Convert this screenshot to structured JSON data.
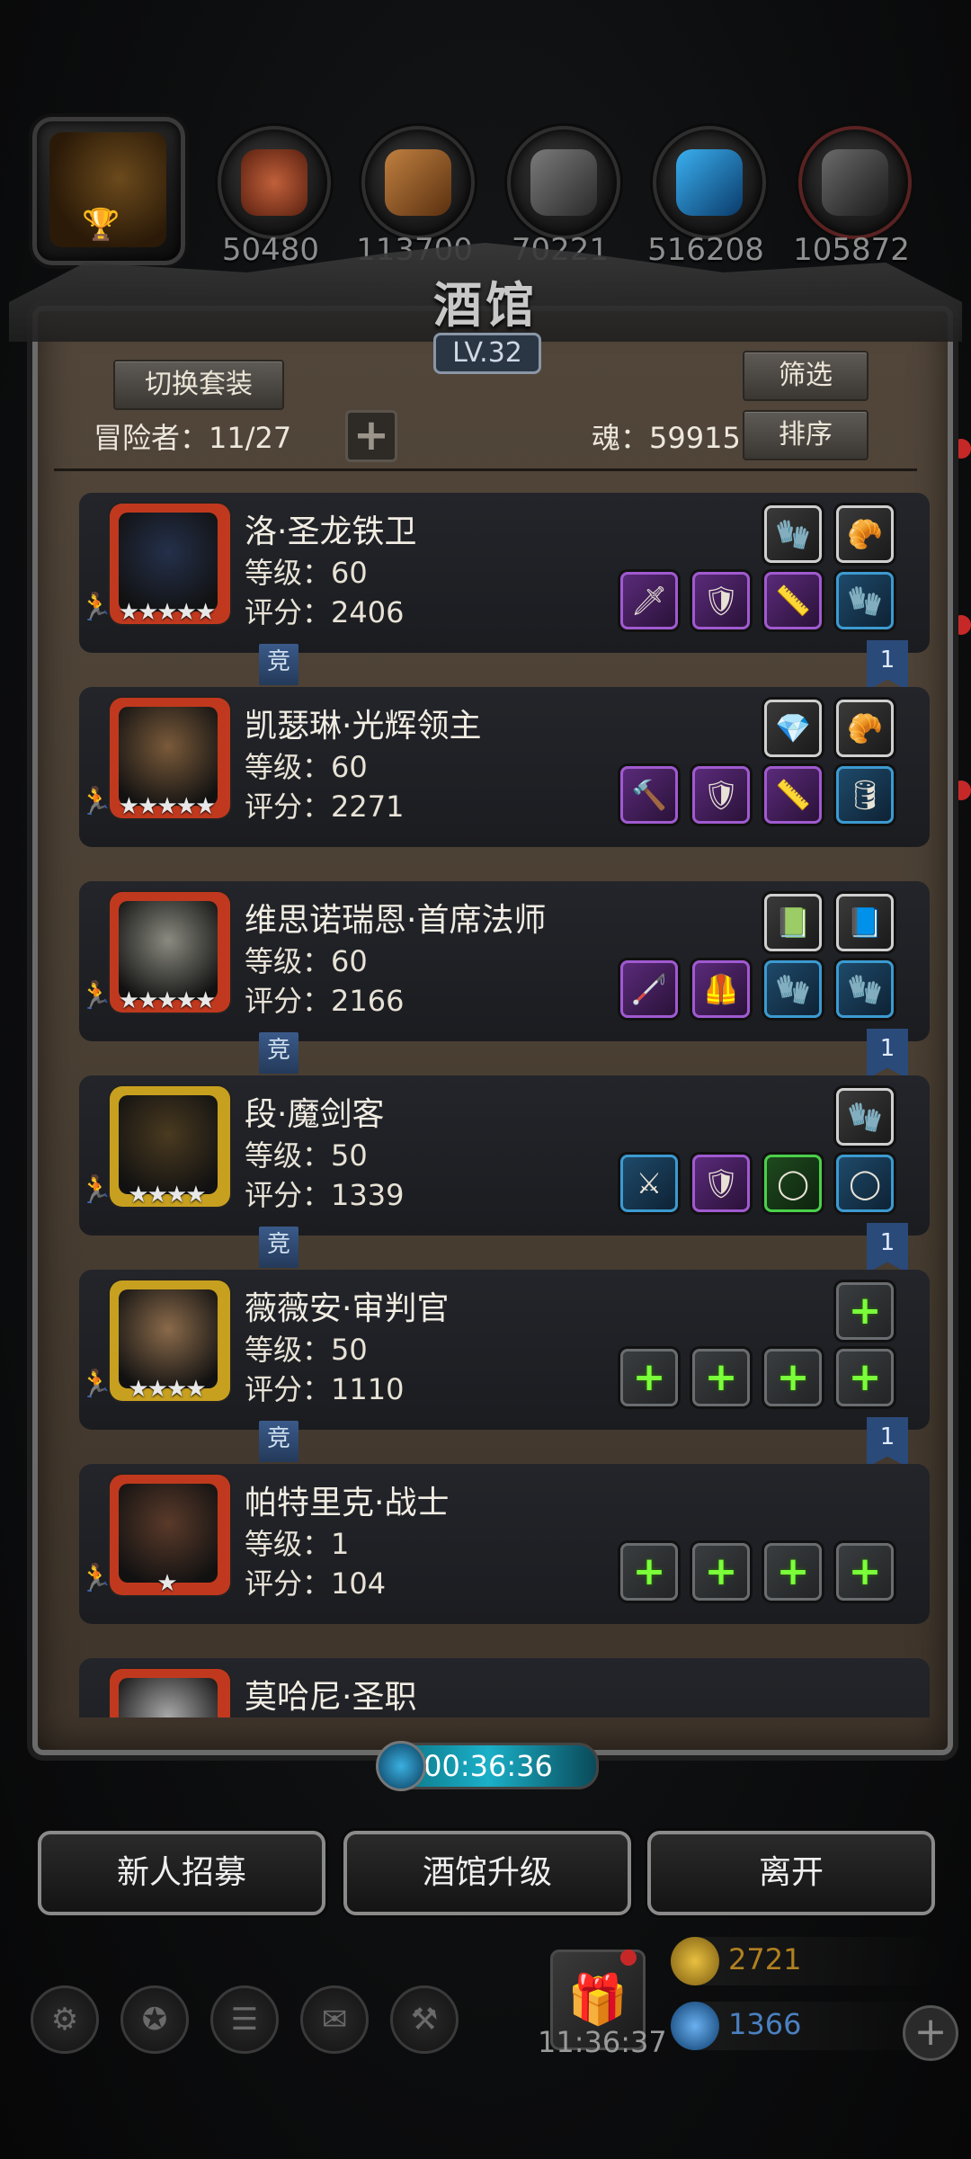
{
  "resources": [
    {
      "name": "hero-portrait",
      "value": ""
    },
    {
      "name": "meat",
      "value": "50480",
      "color": "#a0502a"
    },
    {
      "name": "wood",
      "value": "113700",
      "color": "#a06a30"
    },
    {
      "name": "iron",
      "value": "70221",
      "color": "#5a5a5a"
    },
    {
      "name": "crystal",
      "value": "516208",
      "color": "#2a8ad0"
    },
    {
      "name": "stone",
      "value": "105872",
      "color": "#4a4a4a"
    }
  ],
  "header": {
    "title": "酒馆",
    "level": "LV.32",
    "switch_outfit": "切换套装",
    "filter": "筛选",
    "sort": "排序",
    "adventurers_label": "冒险者：11/27",
    "soul_label": "魂：59915"
  },
  "heroes": [
    {
      "name": "洛·圣龙铁卫",
      "level": "等级：60",
      "score": "评分：2406",
      "stars": "★★★★★",
      "frame": "#c0391e",
      "face": "#24304a",
      "tag_jing": "竞",
      "tag_num": "1",
      "top_slots": [
        "w",
        "w"
      ],
      "bottom_slots": [
        "p",
        "p",
        "p",
        "b"
      ],
      "top_icons": [
        "🧤",
        "🥐"
      ],
      "bottom_icons": [
        "🗡",
        "🛡",
        "📏",
        "🧤"
      ]
    },
    {
      "name": "凯瑟琳·光辉领主",
      "level": "等级：60",
      "score": "评分：2271",
      "stars": "★★★★★",
      "frame": "#c0391e",
      "face": "#7a5a3a",
      "tag_jing": "",
      "tag_num": "",
      "top_slots": [
        "w",
        "w"
      ],
      "bottom_slots": [
        "p",
        "p",
        "p",
        "b"
      ],
      "top_icons": [
        "💎",
        "🥐"
      ],
      "bottom_icons": [
        "🔨",
        "🛡",
        "📏",
        "🛢"
      ]
    },
    {
      "name": "维思诺瑞恩·首席法师",
      "level": "等级：60",
      "score": "评分：2166",
      "stars": "★★★★★",
      "frame": "#c0391e",
      "face": "#8a8a80",
      "tag_jing": "竞",
      "tag_num": "1",
      "top_slots": [
        "w",
        "w"
      ],
      "bottom_slots": [
        "p",
        "p",
        "b",
        "b"
      ],
      "top_icons": [
        "📗",
        "📘"
      ],
      "bottom_icons": [
        "🦯",
        "🦺",
        "🧤",
        "🧤"
      ]
    },
    {
      "name": "段·魔剑客",
      "level": "等级：50",
      "score": "评分：1339",
      "stars": "★★★★",
      "frame": "#c8a020",
      "face": "#4a3a20",
      "tag_jing": "竞",
      "tag_num": "1",
      "top_slots": [
        "w"
      ],
      "bottom_slots": [
        "b",
        "p",
        "g",
        "b"
      ],
      "top_icons": [
        "🧤"
      ],
      "bottom_icons": [
        "⚔",
        "🛡",
        "◯",
        "◯"
      ]
    },
    {
      "name": "薇薇安·审判官",
      "level": "等级：50",
      "score": "评分：1110",
      "stars": "★★★★",
      "frame": "#c8a020",
      "face": "#8a6a4a",
      "tag_jing": "竞",
      "tag_num": "1",
      "top_slots": [
        "e"
      ],
      "bottom_slots": [
        "e",
        "e",
        "e",
        "e"
      ],
      "top_icons": [
        "+"
      ],
      "bottom_icons": [
        "+",
        "+",
        "+",
        "+"
      ]
    },
    {
      "name": "帕特里克·战士",
      "level": "等级：1",
      "score": "评分：104",
      "stars": "★",
      "frame": "#c0391e",
      "face": "#5a3a2a",
      "tag_jing": "",
      "tag_num": "",
      "top_slots": [],
      "bottom_slots": [
        "e",
        "e",
        "e",
        "e"
      ],
      "top_icons": [],
      "bottom_icons": [
        "+",
        "+",
        "+",
        "+"
      ]
    },
    {
      "name": "莫哈尼·圣职",
      "level": "",
      "score": "",
      "stars": "",
      "frame": "#c0391e",
      "face": "#aaaaaa",
      "tag_jing": "",
      "tag_num": "",
      "top_slots": [],
      "bottom_slots": [],
      "top_icons": [],
      "bottom_icons": []
    }
  ],
  "timer": "00:36:36",
  "actions": {
    "recruit": "新人招募",
    "upgrade": "酒馆升级",
    "leave": "离开"
  },
  "bottom": {
    "clock": "11:36:37",
    "gold": "2721",
    "gems": "1366"
  },
  "colors": {
    "gold": "#d4a020",
    "gem": "#3a90e0"
  }
}
